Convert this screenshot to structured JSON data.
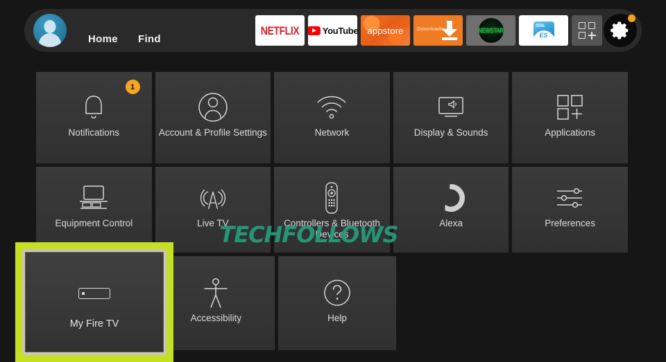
{
  "topbar": {
    "avatar": "profile-avatar",
    "nav": [
      {
        "id": "home",
        "label": "Home"
      },
      {
        "id": "find",
        "label": "Find"
      }
    ],
    "apps": [
      {
        "id": "netflix",
        "label": "NETFLIX",
        "icon": "netflix-icon"
      },
      {
        "id": "youtube",
        "label": "YouTube",
        "icon": "youtube-icon"
      },
      {
        "id": "appstore",
        "label": "appstore",
        "icon": "appstore-icon"
      },
      {
        "id": "downloader",
        "label": "Downloader",
        "icon": "downloader-icon"
      },
      {
        "id": "kodi",
        "label": "NEWSTAR",
        "icon": "green-circle-app-icon"
      },
      {
        "id": "esfile",
        "label": "ES",
        "icon": "es-file-explorer-icon"
      }
    ],
    "apps_grid_button": "apps-grid-icon",
    "settings_button": "gear-icon",
    "settings_badge_color": "#f7a01d"
  },
  "settings_grid": {
    "rows": [
      [
        {
          "id": "notifications",
          "label": "Notifications",
          "icon": "bell-icon",
          "badge": "1"
        },
        {
          "id": "account",
          "label": "Account & Profile Settings",
          "icon": "person-circle-icon"
        },
        {
          "id": "network",
          "label": "Network",
          "icon": "wifi-icon"
        },
        {
          "id": "display",
          "label": "Display & Sounds",
          "icon": "tv-speaker-icon"
        },
        {
          "id": "applications",
          "label": "Applications",
          "icon": "app-squares-icon"
        }
      ],
      [
        {
          "id": "equipment",
          "label": "Equipment Control",
          "icon": "tv-stand-icon"
        },
        {
          "id": "livetv",
          "label": "Live TV",
          "icon": "antenna-icon"
        },
        {
          "id": "controllers",
          "label": "Controllers & Bluetooth Devices",
          "icon": "remote-control-icon"
        },
        {
          "id": "alexa",
          "label": "Alexa",
          "icon": "alexa-ring-icon"
        },
        {
          "id": "preferences",
          "label": "Preferences",
          "icon": "sliders-icon"
        }
      ],
      [
        {
          "id": "myfiretv",
          "label": "My Fire TV",
          "icon": "firestick-icon",
          "selected": true
        },
        {
          "id": "accessibility",
          "label": "Accessibility",
          "icon": "accessibility-icon"
        },
        {
          "id": "help",
          "label": "Help",
          "icon": "question-circle-icon"
        }
      ]
    ],
    "selection_color": "#c4e021"
  },
  "watermark": {
    "text": "TECHFOLLOWS",
    "color": "#25a07b"
  }
}
